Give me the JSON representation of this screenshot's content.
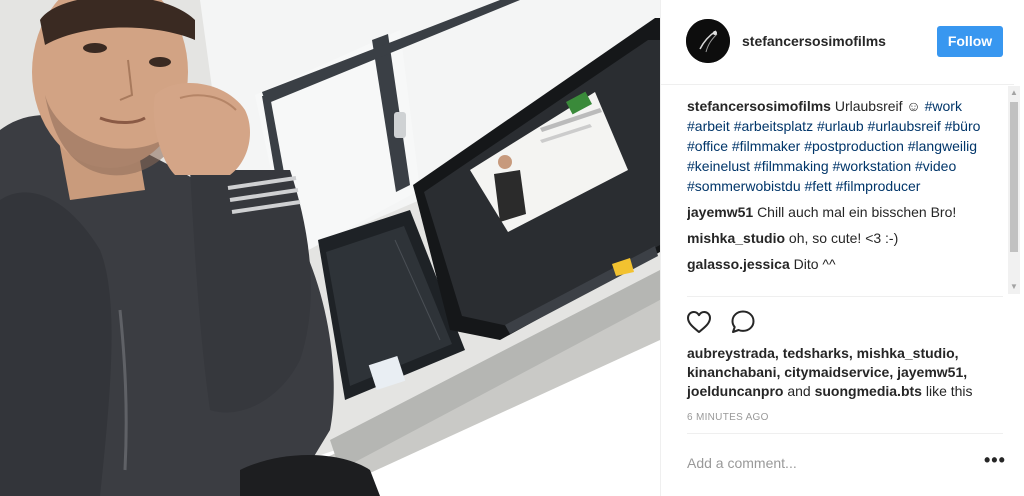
{
  "post": {
    "username": "stefancersosimofilms",
    "follow_label": "Follow",
    "caption": {
      "user": "stefancersosimofilms",
      "text": "Urlaubsreif ☺",
      "hashtags": "#work #arbeit #arbeitsplatz #urlaub #urlaubsreif #büro #office #filmmaker #postproduction #langweilig #keinelust #filmmaking #workstation #video #sommerwobistdu #fett #filmproducer"
    },
    "comments": [
      {
        "user": "jayemw51",
        "text": "Chill auch mal ein bisschen Bro!"
      },
      {
        "user": "mishka_studio",
        "text": "oh, so cute! <3 :-)"
      },
      {
        "user": "galasso.jessica",
        "text": "Dito ^^"
      }
    ],
    "likes": {
      "users": [
        "aubreystrada",
        "tedsharks",
        "mishka_studio",
        "kinanchabani",
        "citymaidservice",
        "jayemw51",
        "joelduncanpro"
      ],
      "last_user": "suongmedia.bts",
      "and_label": "and",
      "suffix": "like this",
      "line1": "aubreystrada, tedsharks, mishka_studio,",
      "line2": "kinanchabani, citymaidservice, jayemw51,",
      "line3_user": "joelduncanpro"
    },
    "timestamp": "6 MINUTES AGO",
    "add_comment_placeholder": "Add a comment...",
    "more_label": "•••"
  },
  "icons": {
    "like": "heart-icon",
    "comment": "comment-bubble-icon",
    "more": "more-options-icon",
    "scroll_up": "▲",
    "scroll_down": "▼"
  },
  "colors": {
    "follow_button": "#3897f0",
    "hashtag": "#003569",
    "muted": "#999999",
    "border": "#efefef"
  }
}
